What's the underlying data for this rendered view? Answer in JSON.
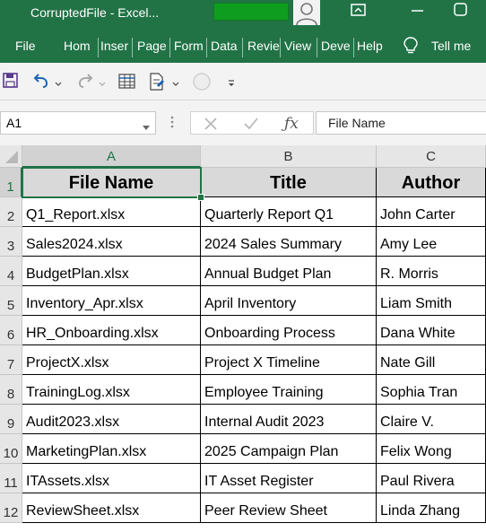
{
  "app": {
    "window_title": "CorruptedFile  -  Excel...",
    "accent_color": "#217346"
  },
  "ribbon": {
    "tabs": [
      "File",
      "Hom",
      "Inser",
      "Page",
      "Form",
      "Data",
      "Revie",
      "View",
      "Deve",
      "Help"
    ],
    "tell_me": "Tell me"
  },
  "quick_access": {
    "icons": [
      "save-icon",
      "undo-icon",
      "redo-icon",
      "print-preview-icon",
      "format-painter-icon",
      "circle-icon",
      "customize-icon"
    ]
  },
  "formula_bar": {
    "name_box": "A1",
    "content": "File Name"
  },
  "grid": {
    "columns": [
      "A",
      "B",
      "C"
    ],
    "selected_column": "A",
    "selected_row": "1",
    "header": {
      "row": "1",
      "cells": [
        "File Name",
        "Title",
        "Author"
      ]
    },
    "rows": [
      {
        "row": "2",
        "cells": [
          "Q1_Report.xlsx",
          "Quarterly Report Q1",
          "John Carter"
        ]
      },
      {
        "row": "3",
        "cells": [
          "Sales2024.xlsx",
          "2024 Sales Summary",
          "Amy Lee"
        ]
      },
      {
        "row": "4",
        "cells": [
          "BudgetPlan.xlsx",
          "Annual Budget Plan",
          "R. Morris"
        ]
      },
      {
        "row": "5",
        "cells": [
          "Inventory_Apr.xlsx",
          "April Inventory",
          "Liam Smith"
        ]
      },
      {
        "row": "6",
        "cells": [
          "HR_Onboarding.xlsx",
          "Onboarding Process",
          "Dana White"
        ]
      },
      {
        "row": "7",
        "cells": [
          "ProjectX.xlsx",
          "Project X Timeline",
          "Nate Gill"
        ]
      },
      {
        "row": "8",
        "cells": [
          "TrainingLog.xlsx",
          "Employee Training",
          "Sophia Tran"
        ]
      },
      {
        "row": "9",
        "cells": [
          "Audit2023.xlsx",
          "Internal Audit 2023",
          "Claire V."
        ]
      },
      {
        "row": "10",
        "cells": [
          "MarketingPlan.xlsx",
          "2025 Campaign Plan",
          "Felix Wong"
        ]
      },
      {
        "row": "11",
        "cells": [
          "ITAssets.xlsx",
          "IT Asset Register",
          "Paul Rivera"
        ]
      },
      {
        "row": "12",
        "cells": [
          "ReviewSheet.xlsx",
          "Peer Review Sheet",
          "Linda Zhang"
        ]
      }
    ]
  }
}
